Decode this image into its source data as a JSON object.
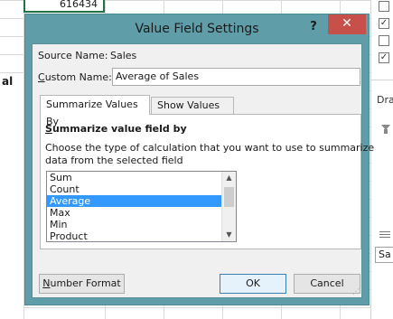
{
  "spreadsheet": {
    "cell_value": "616434",
    "row_label": "al"
  },
  "right_pane": {
    "checkboxes": [
      "",
      "✓",
      "",
      "✓"
    ],
    "label_dr": "Dra",
    "search_text": "Sa"
  },
  "dialog": {
    "title": "Value Field Settings",
    "help_label": "?",
    "close_label": "✕",
    "source_name_label": "Source Name:",
    "source_name_value": "Sales",
    "custom_name_label_prefix": "C",
    "custom_name_label_rest": "ustom Name:",
    "custom_name_value": "Average of Sales",
    "tabs": [
      {
        "label": "Summarize Values By",
        "active": true
      },
      {
        "label": "Show Values As",
        "active": false
      }
    ],
    "section_heading_prefix": "S",
    "section_heading_rest": "ummarize value field by",
    "description_line1": "Choose the type of calculation that you want to use to summarize",
    "description_line2": "data from the selected field",
    "list_items": [
      "Sum",
      "Count",
      "Average",
      "Max",
      "Min",
      "Product"
    ],
    "selected_item": "Average",
    "number_format_prefix": "N",
    "number_format_rest": "umber Format",
    "ok_label": "OK",
    "cancel_label": "Cancel"
  },
  "colors": {
    "dialog_frame": "#5f9ea8",
    "close_button": "#c7504a",
    "selection": "#3399ff"
  }
}
